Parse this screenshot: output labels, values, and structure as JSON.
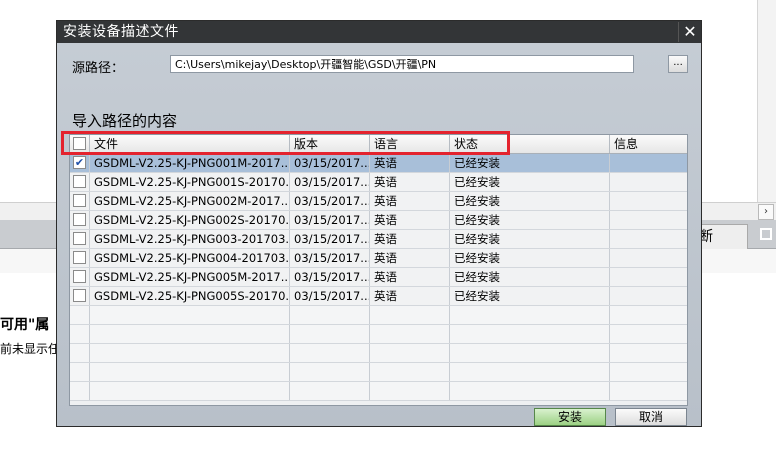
{
  "background": {
    "tab_label": "断",
    "text_line1": "可用\"属",
    "text_line2": "前未显示任",
    "hscroll_arrow": "›"
  },
  "dialog": {
    "title": "安装设备描述文件",
    "close_glyph": "✕",
    "source_label": "源路径：",
    "source_path": "C:\\Users\\mikejay\\Desktop\\开疆智能\\GSD\\开疆\\PN",
    "browse_label": "...",
    "section_title": "导入路径的内容",
    "columns": [
      "文件",
      "版本",
      "语言",
      "状态",
      "信息"
    ],
    "rows": [
      {
        "file": "GSDML-V2.25-KJ-PNG001M-2017...",
        "version": "03/15/2017...",
        "language": "英语",
        "status": "已经安装",
        "info": "",
        "checked": true
      },
      {
        "file": "GSDML-V2.25-KJ-PNG001S-20170...",
        "version": "03/15/2017...",
        "language": "英语",
        "status": "已经安装",
        "info": "",
        "checked": false
      },
      {
        "file": "GSDML-V2.25-KJ-PNG002M-2017...",
        "version": "03/15/2017...",
        "language": "英语",
        "status": "已经安装",
        "info": "",
        "checked": false
      },
      {
        "file": "GSDML-V2.25-KJ-PNG002S-20170...",
        "version": "03/15/2017...",
        "language": "英语",
        "status": "已经安装",
        "info": "",
        "checked": false
      },
      {
        "file": "GSDML-V2.25-KJ-PNG003-201703...",
        "version": "03/15/2017...",
        "language": "英语",
        "status": "已经安装",
        "info": "",
        "checked": false
      },
      {
        "file": "GSDML-V2.25-KJ-PNG004-201703...",
        "version": "03/15/2017...",
        "language": "英语",
        "status": "已经安装",
        "info": "",
        "checked": false
      },
      {
        "file": "GSDML-V2.25-KJ-PNG005M-2017...",
        "version": "03/15/2017...",
        "language": "英语",
        "status": "已经安装",
        "info": "",
        "checked": false
      },
      {
        "file": "GSDML-V2.25-KJ-PNG005S-20170...",
        "version": "03/15/2017...",
        "language": "英语",
        "status": "已经安装",
        "info": "",
        "checked": false
      }
    ],
    "install_label": "安装",
    "cancel_label": "取消",
    "check_glyph": "✔"
  },
  "colors": {
    "highlight": "#e4232e",
    "selected_row": "#a8bfd9",
    "install_button": "#9cd184"
  }
}
